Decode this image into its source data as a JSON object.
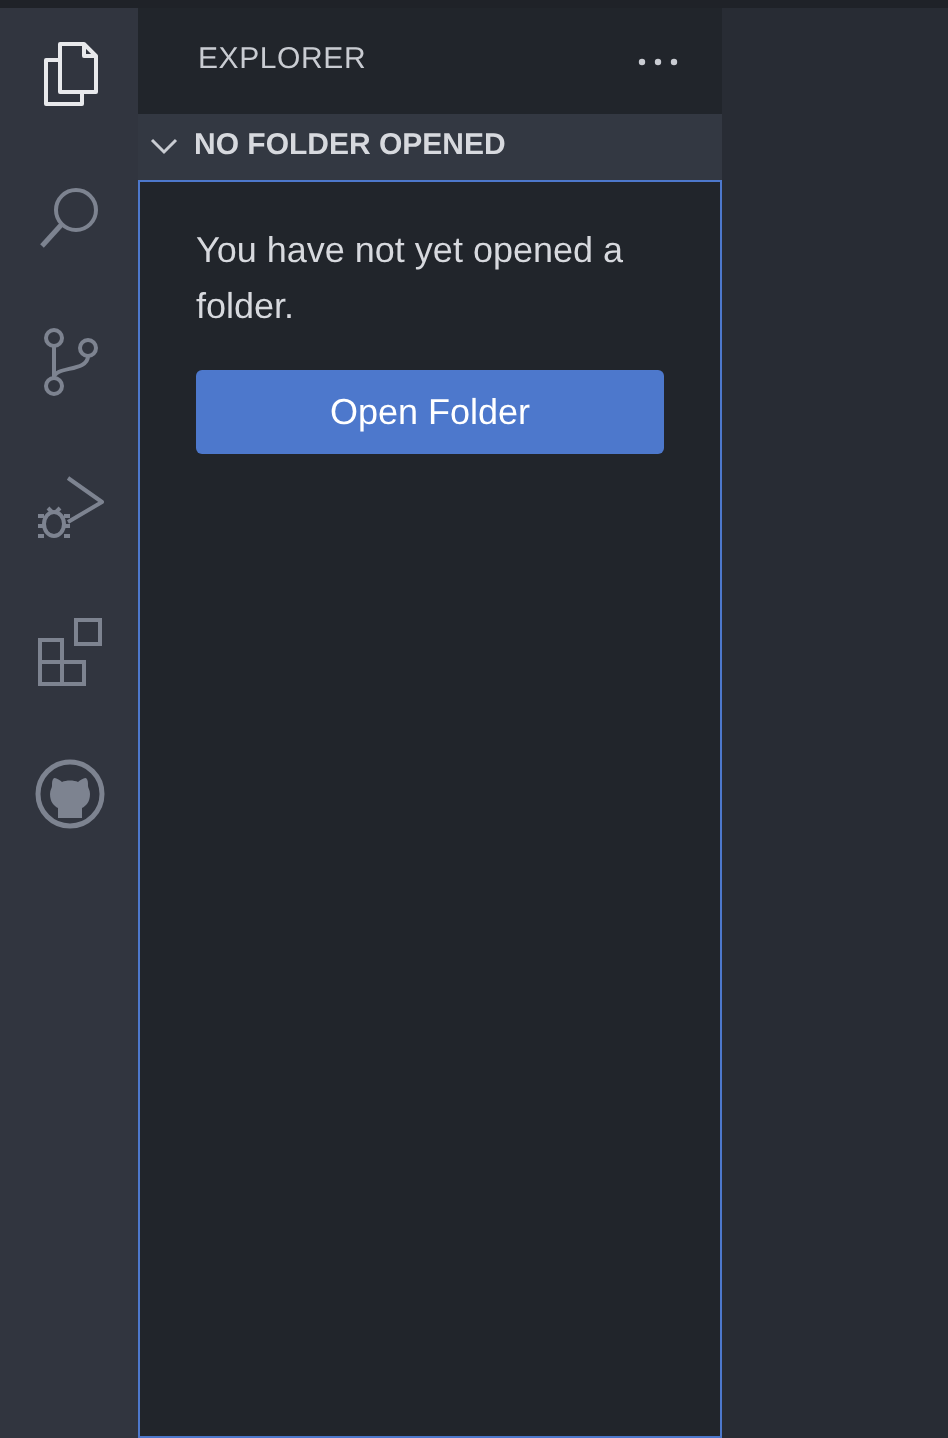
{
  "activity_bar": [
    {
      "kind": "files",
      "selected": true
    },
    {
      "kind": "search",
      "selected": false
    },
    {
      "kind": "source-control",
      "selected": false
    },
    {
      "kind": "run-debug",
      "selected": false
    },
    {
      "kind": "extensions",
      "selected": false
    },
    {
      "kind": "github",
      "selected": false
    }
  ],
  "sidebar": {
    "title": "EXPLORER",
    "section": {
      "title": "NO FOLDER OPENED",
      "expanded": true,
      "focused": true,
      "message": "You have not yet opened a folder.",
      "button": "Open Folder"
    }
  }
}
